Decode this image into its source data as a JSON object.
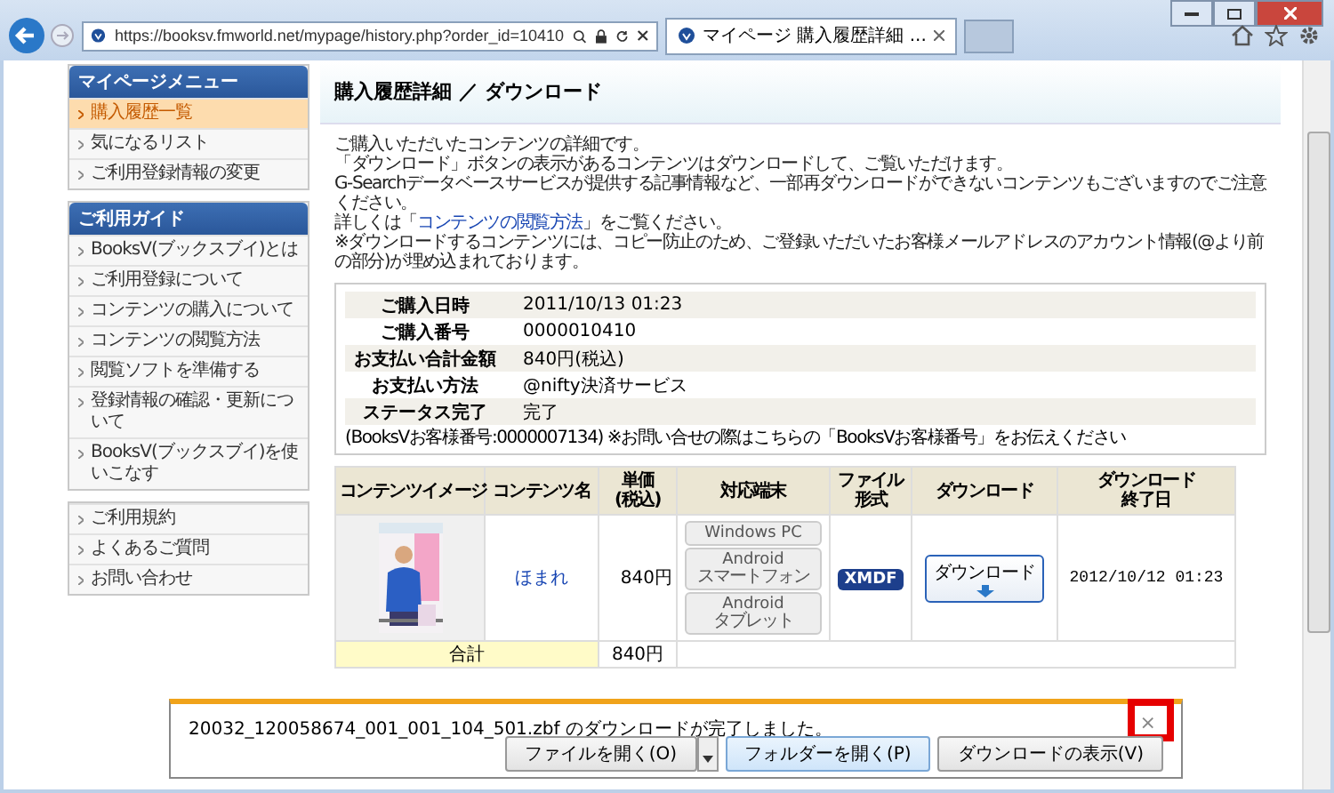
{
  "browser": {
    "url": "https://booksv.fmworld.net/mypage/history.php?order_id=10410",
    "tabs": [
      {
        "label": "マイページ 購入履歴詳細 ...",
        "selected": true
      }
    ]
  },
  "sidebar": {
    "sections": [
      {
        "title": "マイページメニュー",
        "items": [
          {
            "label": "購入履歴一覧",
            "selected": true
          },
          {
            "label": "気になるリスト",
            "selected": false
          },
          {
            "label": "ご利用登録情報の変更",
            "selected": false
          }
        ]
      },
      {
        "title": "ご利用ガイド",
        "items": [
          {
            "label": "BooksV(ブックスブイ)とは",
            "selected": false
          },
          {
            "label": "ご利用登録について",
            "selected": false
          },
          {
            "label": "コンテンツの購入について",
            "selected": false
          },
          {
            "label": "コンテンツの閲覧方法",
            "selected": false
          },
          {
            "label": "閲覧ソフトを準備する",
            "selected": false
          },
          {
            "label": "登録情報の確認・更新について",
            "selected": false
          },
          {
            "label": "BooksV(ブックスブイ)を使いこなす",
            "selected": false
          }
        ]
      },
      {
        "items": [
          {
            "label": "ご利用規約",
            "selected": false
          },
          {
            "label": "よくあるご質問",
            "selected": false
          },
          {
            "label": "お問い合わせ",
            "selected": false
          }
        ]
      }
    ]
  },
  "page": {
    "title": "購入履歴詳細 ／ ダウンロード",
    "intro": [
      "ご購入いただいたコンテンツの詳細です。",
      "「ダウンロード」ボタンの表示があるコンテンツはダウンロードして、ご覧いただけます。",
      "G-Searchデータベースサービスが提供する記事情報など、一部再ダウンロードができないコンテンツもございますのでご注意ください。"
    ],
    "help_before": "詳しくは「",
    "help_link": "コンテンツの閲覧方法",
    "help_after": "」をご覧ください。",
    "notice": "※ダウンロードするコンテンツには、コピー防止のため、ご登録いただいたお客様メールアドレスのアカウント情報(@より前の部分)が埋め込まれております。",
    "order": [
      {
        "label": "ご購入日時",
        "value": "2011/10/13 01:23"
      },
      {
        "label": "ご購入番号",
        "value": "0000010410"
      },
      {
        "label": "お支払い合計金額",
        "value": "840円(税込)"
      },
      {
        "label": "お支払い方法",
        "value": "@nifty決済サービス"
      },
      {
        "label": "ステータス完了",
        "value": "完了"
      }
    ],
    "customer_note": "(BooksVお客様番号:0000007134)  ※お問い合せの際はこちらの「BooksVお客様番号」をお伝えください",
    "table": {
      "columns": [
        {
          "lines": [
            "コンテンツイメージ"
          ]
        },
        {
          "lines": [
            "コンテンツ名"
          ]
        },
        {
          "lines": [
            "単価",
            "(税込)"
          ]
        },
        {
          "lines": [
            "対応端末"
          ]
        },
        {
          "lines": [
            "ファイル",
            "形式"
          ]
        },
        {
          "lines": [
            "ダウンロード"
          ]
        },
        {
          "lines": [
            "ダウンロード",
            "終了日"
          ]
        }
      ],
      "rows": [
        {
          "name": "ほまれ",
          "price": "840円",
          "devices": [
            {
              "name": "Windows PC"
            },
            {
              "name": "Android",
              "sub": "スマートフォン"
            },
            {
              "name": "Android",
              "sub": "タブレット"
            }
          ],
          "format": "XMDF",
          "download": "ダウンロード",
          "end_date": "2012/10/12 01:23"
        }
      ],
      "total": {
        "label": "合計",
        "value": "840円"
      }
    }
  },
  "download_bar": {
    "message": "20032_120058674_001_001_104_501.zbf のダウンロードが完了しました。",
    "close": "×",
    "buttons": [
      "ファイルを開く(O)",
      "フォルダーを開く(P)",
      "ダウンロードの表示(V)"
    ]
  }
}
